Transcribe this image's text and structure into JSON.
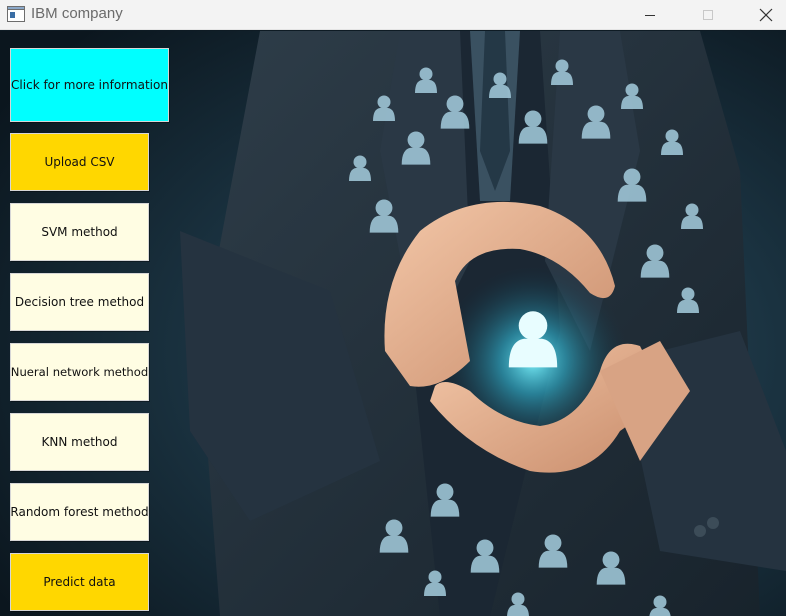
{
  "window": {
    "title": "IBM company",
    "controls": [
      "minimize",
      "maximize",
      "close"
    ]
  },
  "sidebar": {
    "buttons": [
      {
        "id": "info",
        "label": "Click for more information",
        "color": "#00ffff"
      },
      {
        "id": "upload",
        "label": "Upload CSV",
        "color": "#ffd700"
      },
      {
        "id": "svm",
        "label": "SVM method",
        "color": "#fffde3"
      },
      {
        "id": "dt",
        "label": "Decision tree method",
        "color": "#fffde3"
      },
      {
        "id": "nn",
        "label": "Nueral network method",
        "color": "#fffde3"
      },
      {
        "id": "knn",
        "label": "KNN method",
        "color": "#fffde3"
      },
      {
        "id": "rf",
        "label": "Random forest method",
        "color": "#fffde3"
      },
      {
        "id": "predict",
        "label": "Predict data",
        "color": "#ffd700"
      }
    ]
  },
  "background": {
    "image": "businessman-in-suit-protecting-glowing-user-icons-with-hands"
  }
}
